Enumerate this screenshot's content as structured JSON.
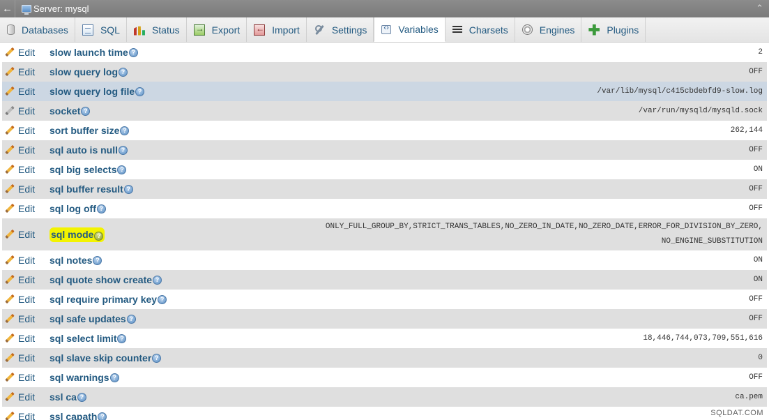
{
  "window": {
    "back_icon": "arrow-left-icon",
    "server_title": "Server: mysql",
    "collapse_icon": "double-chevron-up-icon"
  },
  "tabs": [
    {
      "label": "Databases",
      "icon": "database-icon",
      "active": false
    },
    {
      "label": "SQL",
      "icon": "sql-icon",
      "active": false
    },
    {
      "label": "Status",
      "icon": "status-chart-icon",
      "active": false
    },
    {
      "label": "Export",
      "icon": "export-icon",
      "active": false
    },
    {
      "label": "Import",
      "icon": "import-icon",
      "active": false
    },
    {
      "label": "Settings",
      "icon": "wrench-icon",
      "active": false
    },
    {
      "label": "Variables",
      "icon": "variables-icon",
      "active": true
    },
    {
      "label": "Charsets",
      "icon": "charsets-icon",
      "active": false
    },
    {
      "label": "Engines",
      "icon": "engines-icon",
      "active": false
    },
    {
      "label": "Plugins",
      "icon": "puzzle-icon",
      "active": false
    }
  ],
  "edit_label": "Edit",
  "variables": [
    {
      "name": "slow launch time",
      "value": "2",
      "editable": true
    },
    {
      "name": "slow query log",
      "value": "OFF",
      "editable": true
    },
    {
      "name": "slow query log file",
      "value": "/var/lib/mysql/c415cbdebfd9-slow.log",
      "editable": true,
      "hover": true
    },
    {
      "name": "socket",
      "value": "/var/run/mysqld/mysqld.sock",
      "editable": false
    },
    {
      "name": "sort buffer size",
      "value": "262,144",
      "editable": true
    },
    {
      "name": "sql auto is null",
      "value": "OFF",
      "editable": true
    },
    {
      "name": "sql big selects",
      "value": "ON",
      "editable": true
    },
    {
      "name": "sql buffer result",
      "value": "OFF",
      "editable": true
    },
    {
      "name": "sql log off",
      "value": "OFF",
      "editable": true
    },
    {
      "name": "sql mode",
      "value_lines": [
        "ONLY_FULL_GROUP_BY,STRICT_TRANS_TABLES,NO_ZERO_IN_DATE,NO_ZERO_DATE,ERROR_FOR_DIVISION_BY_ZERO,",
        "NO_ENGINE_SUBSTITUTION"
      ],
      "editable": true,
      "highlighted": true
    },
    {
      "name": "sql notes",
      "value": "ON",
      "editable": true
    },
    {
      "name": "sql quote show create",
      "value": "ON",
      "editable": true
    },
    {
      "name": "sql require primary key",
      "value": "OFF",
      "editable": true
    },
    {
      "name": "sql safe updates",
      "value": "OFF",
      "editable": true
    },
    {
      "name": "sql select limit",
      "value": "18,446,744,073,709,551,616",
      "editable": true
    },
    {
      "name": "sql slave skip counter",
      "value": "0",
      "editable": true
    },
    {
      "name": "sql warnings",
      "value": "OFF",
      "editable": true
    },
    {
      "name": "ssl ca",
      "value": "ca.pem",
      "editable": true
    },
    {
      "name": "ssl capath",
      "value": "",
      "editable": true
    }
  ],
  "watermark": "SQLDAT.COM",
  "colors": {
    "link": "#235a81",
    "row_alt": "#dfdfdf",
    "row_hover": "#ccd7e3",
    "highlight": "#f3f300"
  }
}
